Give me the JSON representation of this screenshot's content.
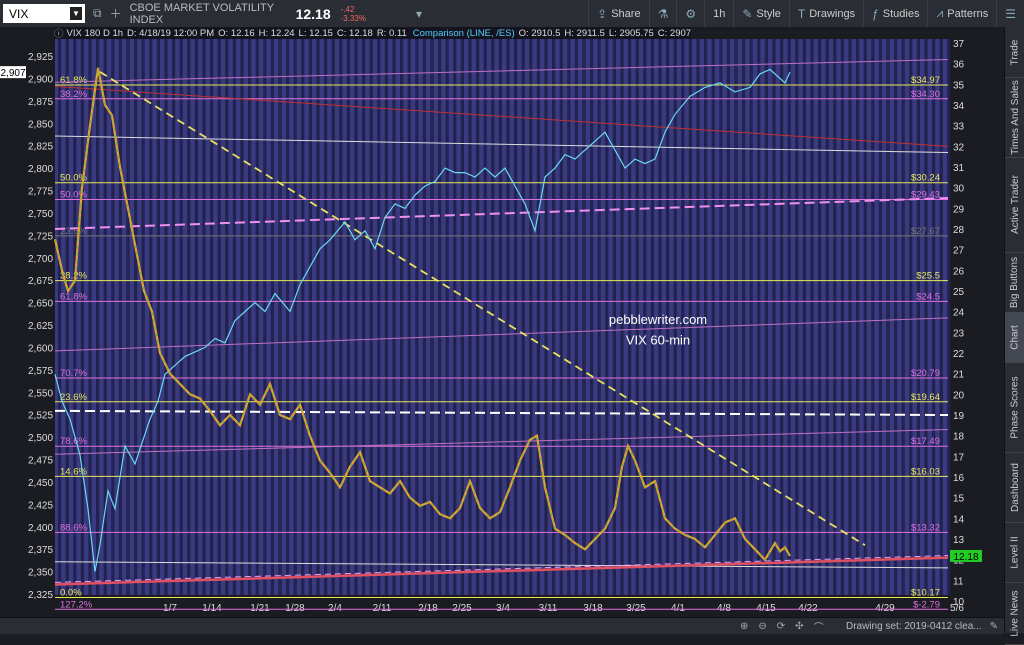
{
  "toolbar": {
    "symbol": "VIX",
    "name": "CBOE MARKET VOLATILITY INDEX",
    "price": "12.18",
    "change": "-.42",
    "change_pct": "-3.33%",
    "share_label": "Share",
    "interval": "1h",
    "style_label": "Style",
    "drawings_label": "Drawings",
    "studies_label": "Studies",
    "patterns_label": "Patterns"
  },
  "infobar": {
    "title": "VIX 180 D 1h",
    "date": "D: 4/18/19 12:00 PM",
    "o": "O: 12.16",
    "h": "H: 12.24",
    "l": "L: 12.15",
    "c": "C: 12.18",
    "r": "R: 0.11",
    "comparison": "Comparison (LINE, /ES)",
    "co": "O: 2910.5",
    "ch": "H: 2911.5",
    "cl": "L: 2905.75",
    "cc": "C: 2907"
  },
  "watermark": [
    "pebblewriter.com",
    "VIX 60-min"
  ],
  "left_axis": [
    "2,925",
    "2,900",
    "2,875",
    "2,850",
    "2,825",
    "2,800",
    "2,775",
    "2,750",
    "2,725",
    "2,700",
    "2,675",
    "2,650",
    "2,625",
    "2,600",
    "2,575",
    "2,550",
    "2,525",
    "2,500",
    "2,475",
    "2,450",
    "2,425",
    "2,400",
    "2,375",
    "2,350",
    "2,325"
  ],
  "left_badge": "2,907",
  "right_axis": [
    "37",
    "36",
    "35",
    "34",
    "33",
    "32",
    "31",
    "30",
    "29",
    "28",
    "27",
    "26",
    "25",
    "24",
    "23",
    "22",
    "21",
    "20",
    "19",
    "18",
    "17",
    "16",
    "15",
    "14",
    "13",
    "12",
    "11",
    "10"
  ],
  "right_badge": "12.18",
  "x_axis": [
    "1/7",
    "1/14",
    "1/21",
    "1/28",
    "2/4",
    "2/11",
    "2/18",
    "2/25",
    "3/4",
    "3/11",
    "3/18",
    "3/25",
    "4/1",
    "4/8",
    "4/15",
    "4/22",
    "4/29",
    "5/6"
  ],
  "fib_left": [
    {
      "label": "61.8%",
      "color": "#e8e85a"
    },
    {
      "label": "38.2%",
      "color": "#e070e0"
    },
    {
      "label": "50.0%",
      "color": "#e8e85a"
    },
    {
      "label": "50.0%",
      "color": "#e070e0"
    },
    {
      "label": "23.6%",
      "color": "#777777"
    },
    {
      "label": "38.2%",
      "color": "#e8e85a"
    },
    {
      "label": "61.8%",
      "color": "#e070e0"
    },
    {
      "label": "70.7%",
      "color": "#e070e0"
    },
    {
      "label": "23.6%",
      "color": "#e8e85a"
    },
    {
      "label": "78.6%",
      "color": "#e070e0"
    },
    {
      "label": "14.6%",
      "color": "#e8e85a"
    },
    {
      "label": "88.6%",
      "color": "#e070e0"
    },
    {
      "label": "0.0%",
      "color": "#e8e85a"
    },
    {
      "label": "127.2%",
      "color": "#e070e0"
    }
  ],
  "fib_right": [
    {
      "label": "$34.97",
      "color": "#e8e85a"
    },
    {
      "label": "$34.30",
      "color": "#e070e0"
    },
    {
      "label": "$30.24",
      "color": "#e8e85a"
    },
    {
      "label": "$29.43",
      "color": "#e070e0"
    },
    {
      "label": "$27.67",
      "color": "#777777"
    },
    {
      "label": "$25.5",
      "color": "#e8e85a"
    },
    {
      "label": "$24.5",
      "color": "#e070e0"
    },
    {
      "label": "$20.79",
      "color": "#e070e0"
    },
    {
      "label": "$19.64",
      "color": "#e8e85a"
    },
    {
      "label": "$17.49",
      "color": "#e070e0"
    },
    {
      "label": "$16.03",
      "color": "#e8e85a"
    },
    {
      "label": "$13.32",
      "color": "#e070e0"
    },
    {
      "label": "$10.17",
      "color": "#e8e85a"
    },
    {
      "label": "$-2.79",
      "color": "#e070e0"
    }
  ],
  "right_tabs": [
    "Trade",
    "Times And Sales",
    "Active Trader",
    "Big Buttons",
    "Chart",
    "Phase Scores",
    "Dashboard",
    "Level II",
    "Live News"
  ],
  "bottom": {
    "drawing_set": "Drawing set: 2019-0412 clea..."
  }
}
